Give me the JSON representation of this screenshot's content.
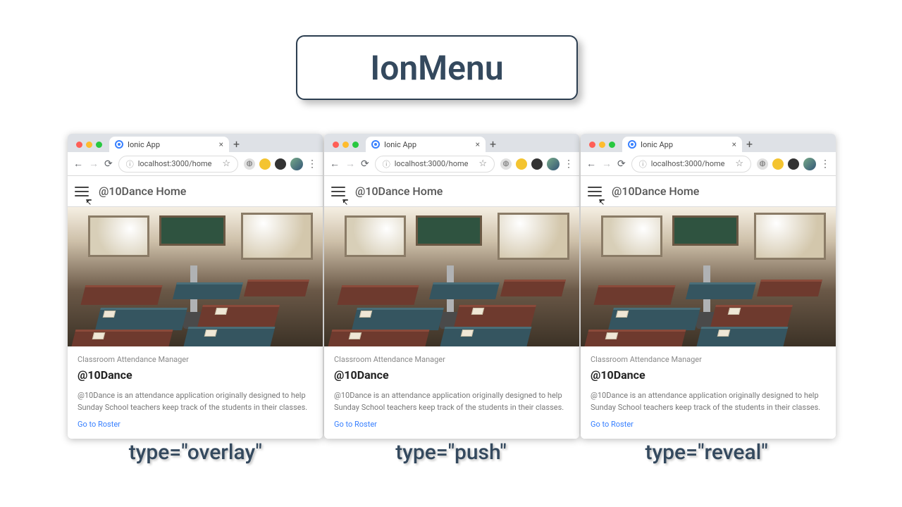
{
  "hero": {
    "title": "IonMenu"
  },
  "browser": {
    "tab_title": "Ionic App",
    "close_glyph": "×",
    "newtab_glyph": "+",
    "back_glyph": "←",
    "fwd_glyph": "→",
    "reload_glyph": "⟳",
    "info_glyph": "ⓘ",
    "url": "localhost:3000/home",
    "star_glyph": "☆",
    "kebab_glyph": "⋮"
  },
  "app": {
    "header": "@10Dance Home",
    "card": {
      "subtitle": "Classroom Attendance Manager",
      "title": "@10Dance",
      "description": "@10Dance is an attendance application originally designed to help Sunday School teachers keep track of the students in their classes.",
      "link_label": "Go to Roster"
    }
  },
  "captions": [
    "type=\"overlay\"",
    "type=\"push\"",
    "type=\"reveal\""
  ]
}
